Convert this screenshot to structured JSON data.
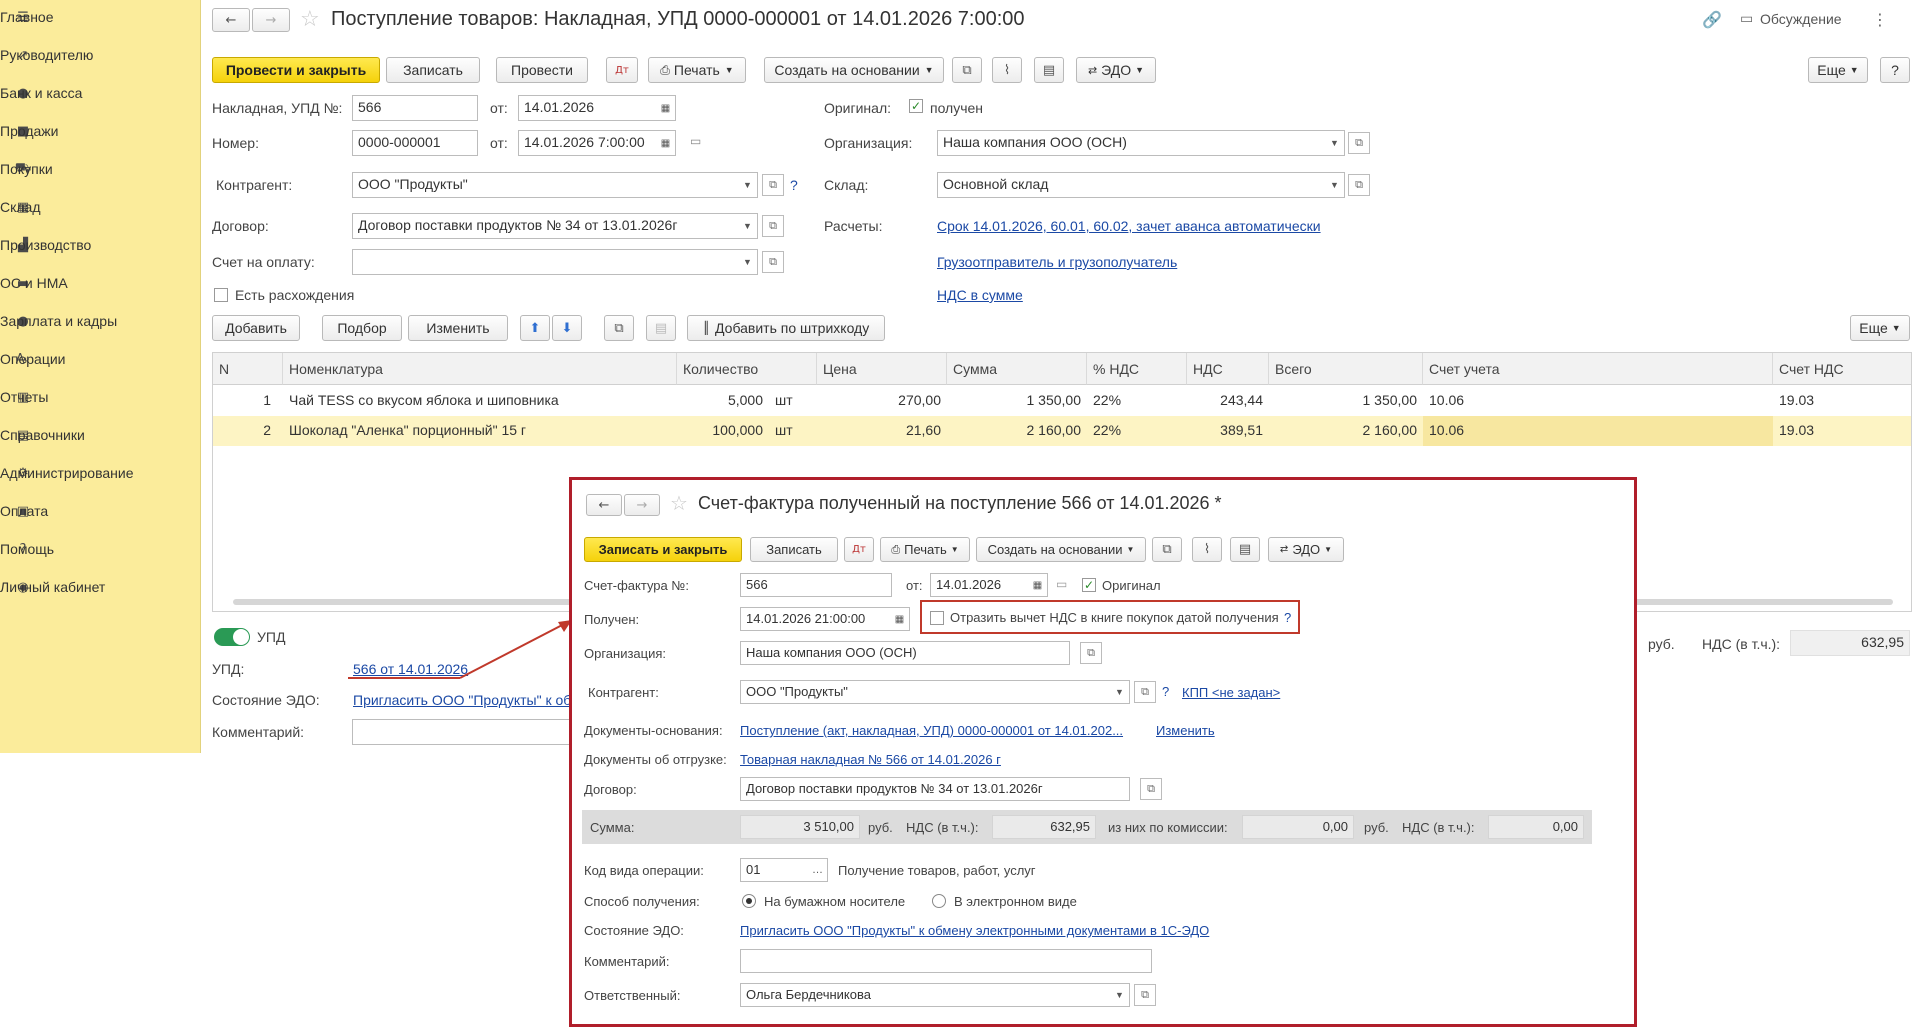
{
  "sidebar": {
    "items": [
      {
        "label": "Главное",
        "icon": "menu-icon",
        "glyph": "☰"
      },
      {
        "label": "Руководителю",
        "icon": "trend-icon",
        "glyph": "↗"
      },
      {
        "label": "Банк и касса",
        "icon": "coins-icon",
        "glyph": "●"
      },
      {
        "label": "Продажи",
        "icon": "bag-icon",
        "glyph": "■"
      },
      {
        "label": "Покупки",
        "icon": "cart-icon",
        "glyph": "⛟"
      },
      {
        "label": "Склад",
        "icon": "warehouse-icon",
        "glyph": "▦"
      },
      {
        "label": "Производство",
        "icon": "factory-icon",
        "glyph": "▟"
      },
      {
        "label": "ОС и НМА",
        "icon": "truck-icon",
        "glyph": "▬"
      },
      {
        "label": "Зарплата и кадры",
        "icon": "person-icon",
        "glyph": "●"
      },
      {
        "label": "Операции",
        "icon": "operations-icon",
        "glyph": "Aₖ"
      },
      {
        "label": "Отчеты",
        "icon": "report-chart-icon",
        "glyph": "▥"
      },
      {
        "label": "Справочники",
        "icon": "books-icon",
        "glyph": "▤"
      },
      {
        "label": "Администрирование",
        "icon": "gear-icon",
        "glyph": "⚙"
      },
      {
        "label": "Оплата",
        "icon": "payment-icon",
        "glyph": "▣"
      },
      {
        "label": "Помощь",
        "icon": "question-icon",
        "glyph": "?"
      },
      {
        "label": "Личный кабинет",
        "icon": "account-icon",
        "glyph": "◉"
      }
    ]
  },
  "header": {
    "title": "Поступление товаров: Накладная, УПД 0000-000001 от 14.01.2026 7:00:00",
    "discussion": "Обсуждение"
  },
  "toolbar": {
    "post_close": "Провести и закрыть",
    "save": "Записать",
    "post": "Провести",
    "print": "Печать",
    "create_based": "Создать на основании",
    "edo": "ЭДО",
    "more": "Еще",
    "help": "?"
  },
  "form": {
    "invoice_label": "Накладная, УПД №:",
    "invoice_value": "566",
    "from_label": "от:",
    "invoice_date": "14.01.2026",
    "number_label": "Номер:",
    "number_value": "0000-000001",
    "number_date": "14.01.2026  7:00:00",
    "counterparty_label": "Контрагент:",
    "counterparty_value": "ООО \"Продукты\"",
    "contract_label": "Договор:",
    "contract_value": "Договор поставки продуктов № 34 от 13.01.2026г",
    "payment_invoice_label": "Счет на оплату:",
    "discrepancy_label": "Есть расхождения",
    "original_label": "Оригинал:",
    "original_value": "получен",
    "org_label": "Организация:",
    "org_value": "Наша компания ООО (ОСН)",
    "warehouse_label": "Склад:",
    "warehouse_value": "Основной склад",
    "settlements_label": "Расчеты:",
    "settlements_link": "Срок 14.01.2026, 60.01, 60.02, зачет аванса автоматически",
    "shipper_link": "Грузоотправитель и грузополучатель",
    "vat_link": "НДС в сумме"
  },
  "table_toolbar": {
    "add": "Добавить",
    "select": "Подбор",
    "change": "Изменить",
    "barcode": "Добавить по штрихкоду",
    "more": "Еще"
  },
  "table": {
    "columns": [
      "N",
      "Номенклатура",
      "Количество",
      "Цена",
      "Сумма",
      "% НДС",
      "НДС",
      "Всего",
      "Счет учета",
      "Счет НДС"
    ],
    "rows": [
      {
        "n": "1",
        "name": "Чай TESS со вкусом яблока и шиповника",
        "qty": "5,000",
        "unit": "шт",
        "price": "270,00",
        "sum": "1 350,00",
        "vat_rate": "22%",
        "vat": "243,44",
        "total": "1 350,00",
        "account": "10.06",
        "vat_account": "19.03"
      },
      {
        "n": "2",
        "name": "Шоколад \"Аленка\" порционный\" 15 г",
        "qty": "100,000",
        "unit": "шт",
        "price": "21,60",
        "sum": "2 160,00",
        "vat_rate": "22%",
        "vat": "389,51",
        "total": "2 160,00",
        "account": "10.06",
        "vat_account": "19.03"
      }
    ]
  },
  "footer": {
    "upd_toggle": "УПД",
    "upd_label": "УПД:",
    "upd_link": "566 от 14.01.2026",
    "edo_label": "Состояние ЭДО:",
    "edo_link": "Пригласить ООО \"Продукты\" к об",
    "comment_label": "Комментарий:",
    "rub": "руб.",
    "vat_incl": "НДС (в т.ч.):",
    "vat_total": "632,95"
  },
  "dialog": {
    "title": "Счет-фактура полученный на поступление 566 от 14.01.2026 *",
    "save_close": "Записать и закрыть",
    "save": "Записать",
    "print": "Печать",
    "create_based": "Создать на основании",
    "edo": "ЭДО",
    "invoice_label": "Счет-фактура №:",
    "invoice_value": "566",
    "from_label": "от:",
    "invoice_date": "14.01.2026",
    "original_label": "Оригинал",
    "received_label": "Получен:",
    "received_value": "14.01.2026 21:00:00",
    "deduct_label": "Отразить вычет НДС в книге покупок датой получения",
    "help": "?",
    "org_label": "Организация:",
    "org_value": "Наша компания ООО (ОСН)",
    "counterparty_label": "Контрагент:",
    "counterparty_value": "ООО \"Продукты\"",
    "kpp_link": "КПП <не задан>",
    "base_docs_label": "Документы-основания:",
    "base_docs_link": "Поступление (акт, накладная, УПД) 0000-000001 от 14.01.202...",
    "change_link": "Изменить",
    "shipping_docs_label": "Документы об отгрузке:",
    "shipping_docs_link": "Товарная накладная № 566 от 14.01.2026 г",
    "contract_label": "Договор:",
    "contract_value": "Договор поставки продуктов № 34 от 13.01.2026г",
    "sum_label": "Сумма:",
    "sum_value": "3 510,00",
    "rub": "руб.",
    "vat_incl": "НДС (в т.ч.):",
    "vat_value": "632,95",
    "commission_label": "из них по комиссии:",
    "commission_value": "0,00",
    "rub2": "руб.",
    "vat_incl2": "НДС (в т.ч.):",
    "commission_vat": "0,00",
    "op_code_label": "Код вида операции:",
    "op_code_value": "01",
    "op_code_desc": "Получение товаров, работ, услуг",
    "receive_method_label": "Способ получения:",
    "paper_label": "На бумажном носителе",
    "electronic_label": "В электронном виде",
    "edo_label": "Состояние ЭДО:",
    "edo_link": "Пригласить ООО \"Продукты\" к обмену электронными документами в 1С-ЭДО",
    "comment_label": "Комментарий:",
    "responsible_label": "Ответственный:",
    "responsible_value": "Ольга Бердечникова"
  },
  "colors": {
    "sidebar": "#fbec9b",
    "accent": "#f5d20b",
    "link": "#1b49a5",
    "highlight": "#fdf4c4",
    "dialog_border": "#b01e2a"
  }
}
